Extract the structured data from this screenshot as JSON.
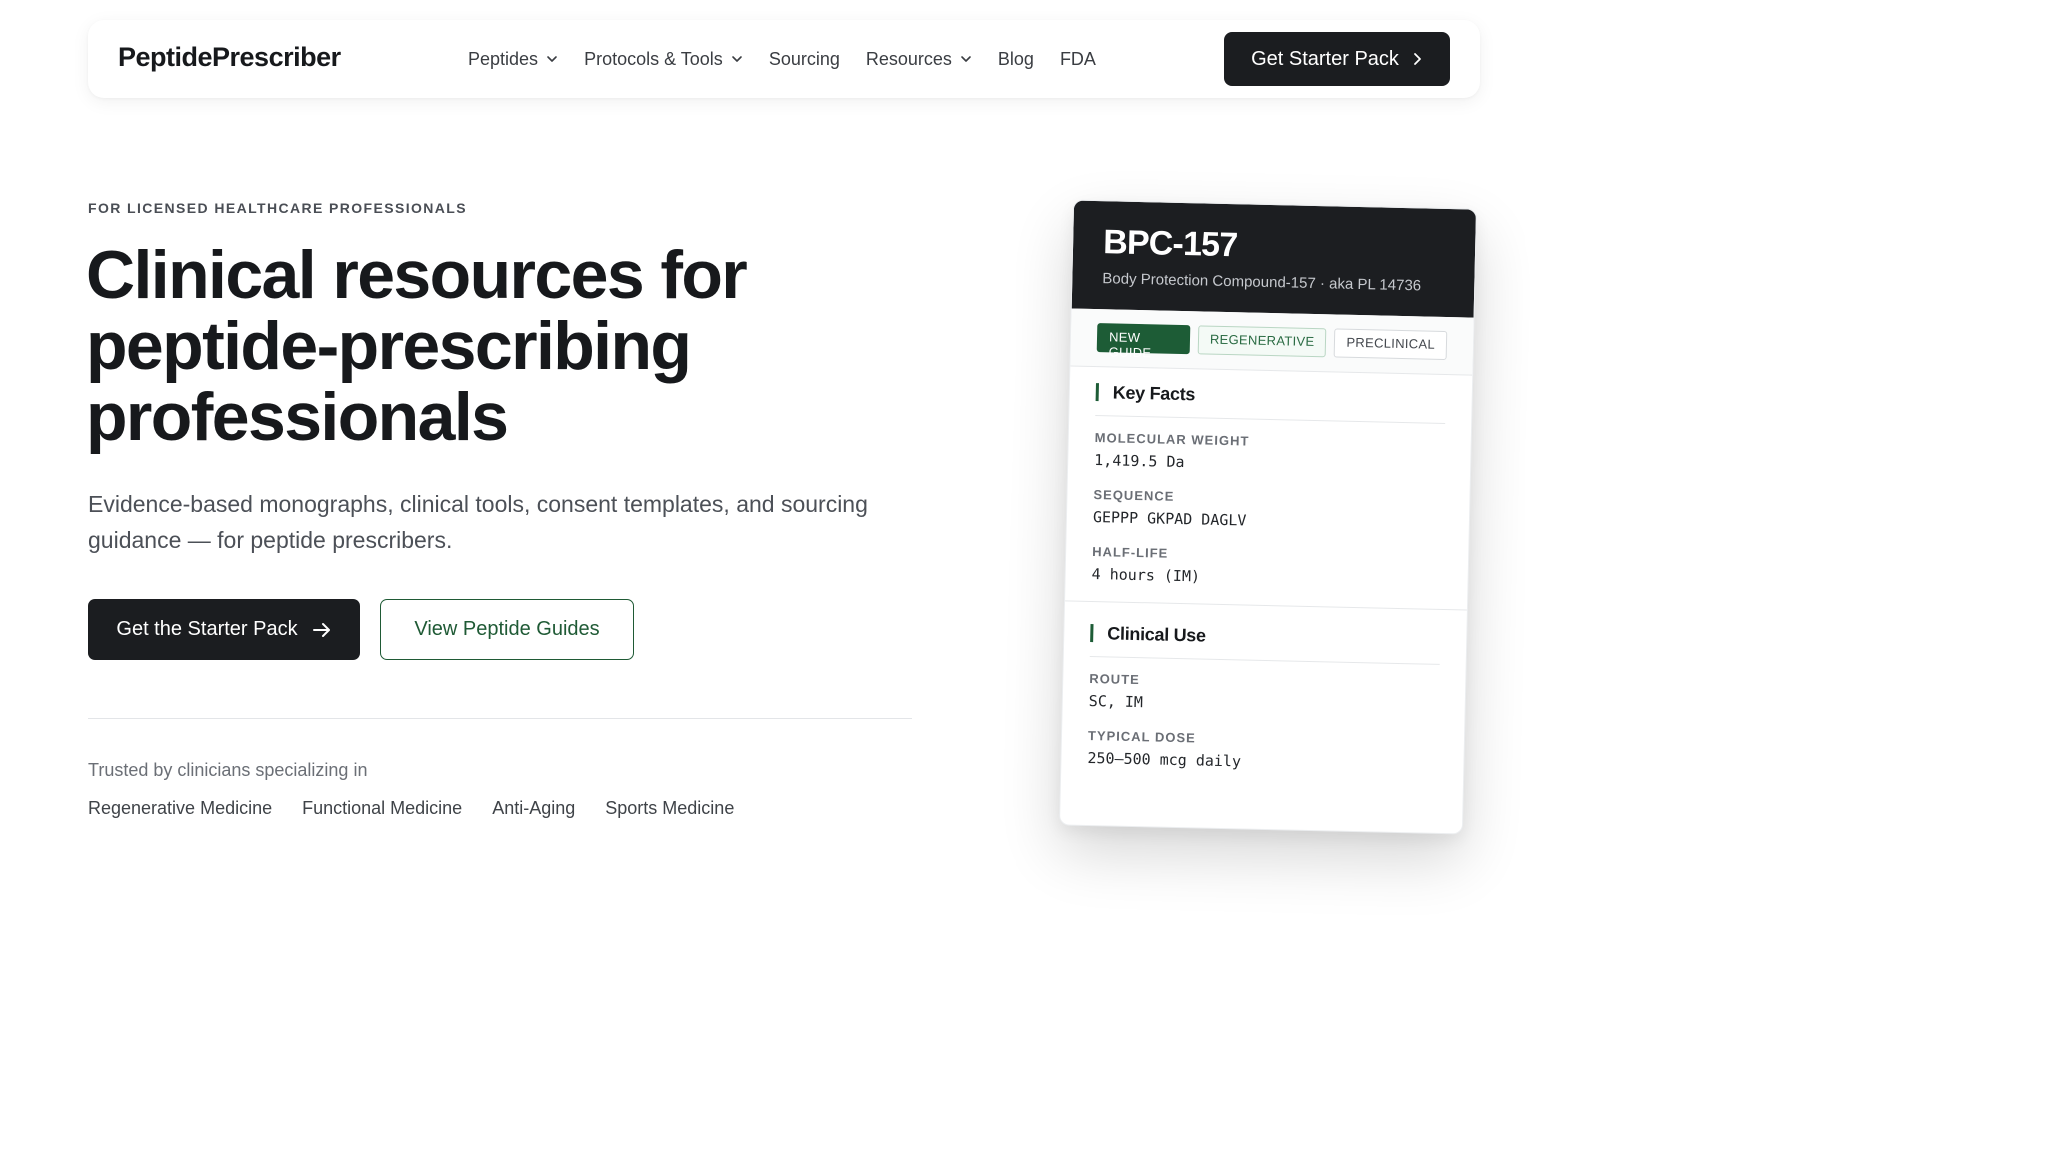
{
  "nav": {
    "logo": "PeptidePrescriber",
    "links": [
      {
        "label": "Peptides",
        "dropdown": true
      },
      {
        "label": "Protocols & Tools",
        "dropdown": true
      },
      {
        "label": "Sourcing",
        "dropdown": false
      },
      {
        "label": "Resources",
        "dropdown": true
      },
      {
        "label": "Blog",
        "dropdown": false
      },
      {
        "label": "FDA",
        "dropdown": false
      }
    ],
    "cta": "Get Starter Pack"
  },
  "hero": {
    "eyebrow": "FOR LICENSED HEALTHCARE PROFESSIONALS",
    "headline_line1": "Clinical resources for",
    "headline_line2": "peptide-prescribing",
    "headline_line3": "professionals",
    "subhead": "Evidence-based monographs, clinical tools, consent templates, and sourcing guidance — for peptide prescribers.",
    "primary_button": "Get the Starter Pack",
    "secondary_button": "View Peptide Guides",
    "trusted_label": "Trusted by clinicians specializing in",
    "specialties": [
      "Regenerative Medicine",
      "Functional Medicine",
      "Anti-Aging",
      "Sports Medicine"
    ]
  },
  "card": {
    "title": "BPC-157",
    "subtitle": "Body Protection Compound-157 · aka PL 14736",
    "badges": [
      "NEW GUIDE",
      "REGENERATIVE",
      "PRECLINICAL"
    ],
    "key_facts": {
      "heading": "Key Facts",
      "fields": [
        {
          "label": "MOLECULAR WEIGHT",
          "value": "1,419.5 Da"
        },
        {
          "label": "SEQUENCE",
          "value": "GEPPP GKPAD DAGLV"
        },
        {
          "label": "HALF-LIFE",
          "value": "4 hours (IM)"
        }
      ]
    },
    "clinical_use": {
      "heading": "Clinical Use",
      "fields": [
        {
          "label": "ROUTE",
          "value": "SC, IM"
        },
        {
          "label": "TYPICAL DOSE",
          "value": "250–500 mcg daily"
        }
      ]
    }
  },
  "colors": {
    "dark": "#1b1d20",
    "accent_green": "#1d5c36",
    "text_muted": "#4c5057"
  },
  "icons": {
    "dropdown": "chevron-down-icon",
    "nav_cta": "chevron-right-icon",
    "primary_button": "arrow-right-icon"
  }
}
